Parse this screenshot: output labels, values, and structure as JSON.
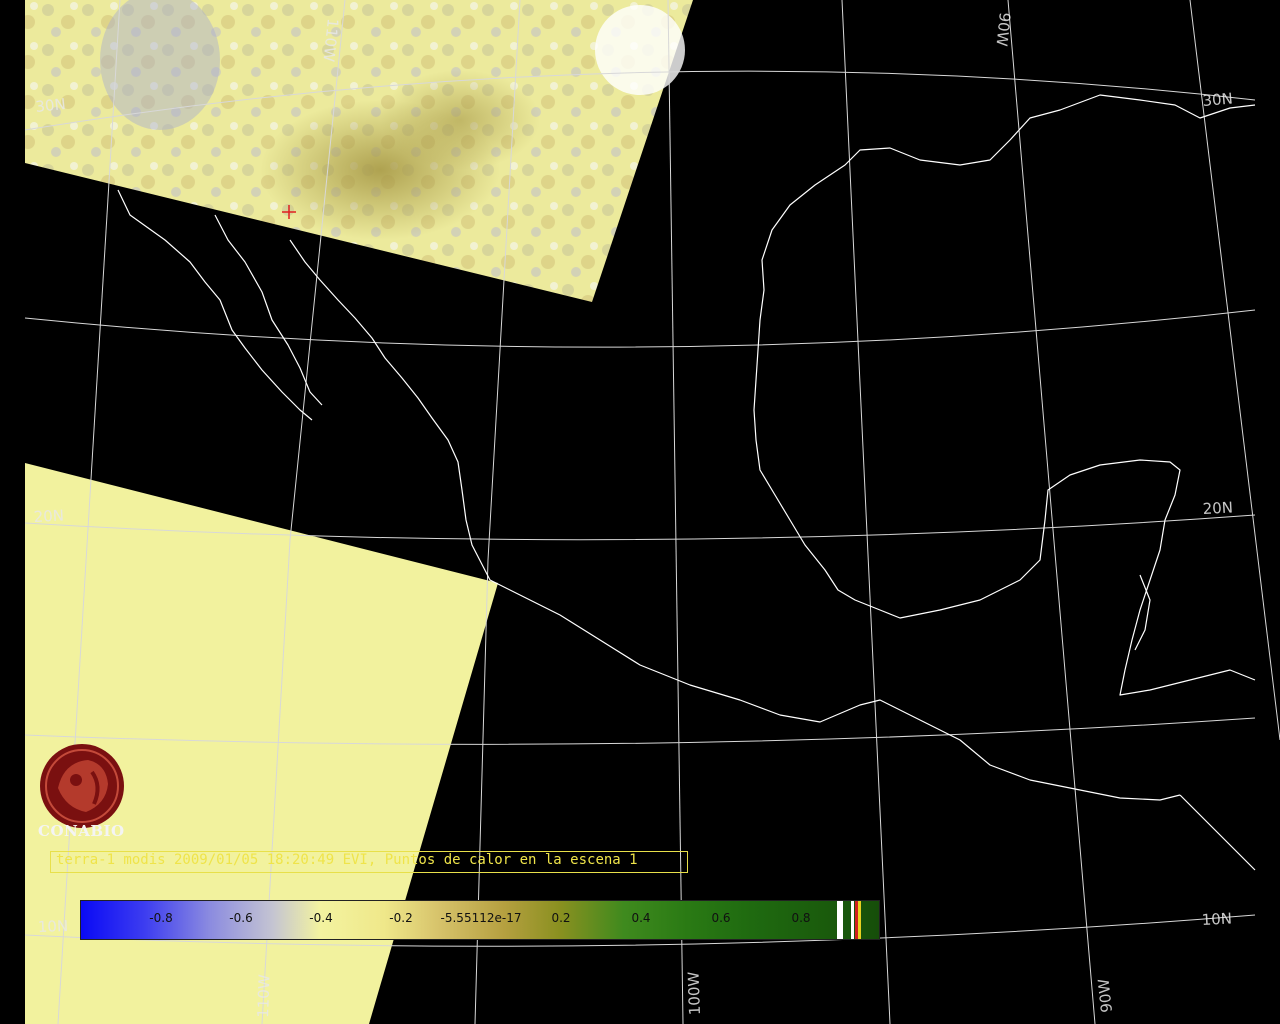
{
  "map": {
    "latitude_labels": [
      "30N",
      "20N",
      "10N",
      "30N",
      "20N",
      "10N"
    ],
    "longitude_labels": [
      "110W",
      "100W",
      "90W",
      "110W",
      "90W"
    ]
  },
  "branding": {
    "logo_icon": "conabio-logo-icon",
    "logo_text": "CONABIO",
    "logo_color": "#7a1010"
  },
  "caption": {
    "text": "terra-1 modis 2009/01/05 18:20:49 EVI, Puntos de calor en la escena 1",
    "color": "#efe44a"
  },
  "colorbar": {
    "ticks": [
      {
        "label": "-0.8",
        "pos": 0.1
      },
      {
        "label": "-0.6",
        "pos": 0.2
      },
      {
        "label": "-0.4",
        "pos": 0.3
      },
      {
        "label": "-0.2",
        "pos": 0.4
      },
      {
        "label": "-5.55112e-17",
        "pos": 0.5
      },
      {
        "label": "0.2",
        "pos": 0.6
      },
      {
        "label": "0.4",
        "pos": 0.7
      },
      {
        "label": "0.6",
        "pos": 0.8
      },
      {
        "label": "0.8",
        "pos": 0.9
      }
    ],
    "colors": {
      "low": "#0a0af5",
      "mid": "#f3f3a0",
      "high": "#164e0a"
    }
  },
  "hotspot": {
    "marker_icon": "red-cross-icon",
    "color": "#e02020"
  }
}
